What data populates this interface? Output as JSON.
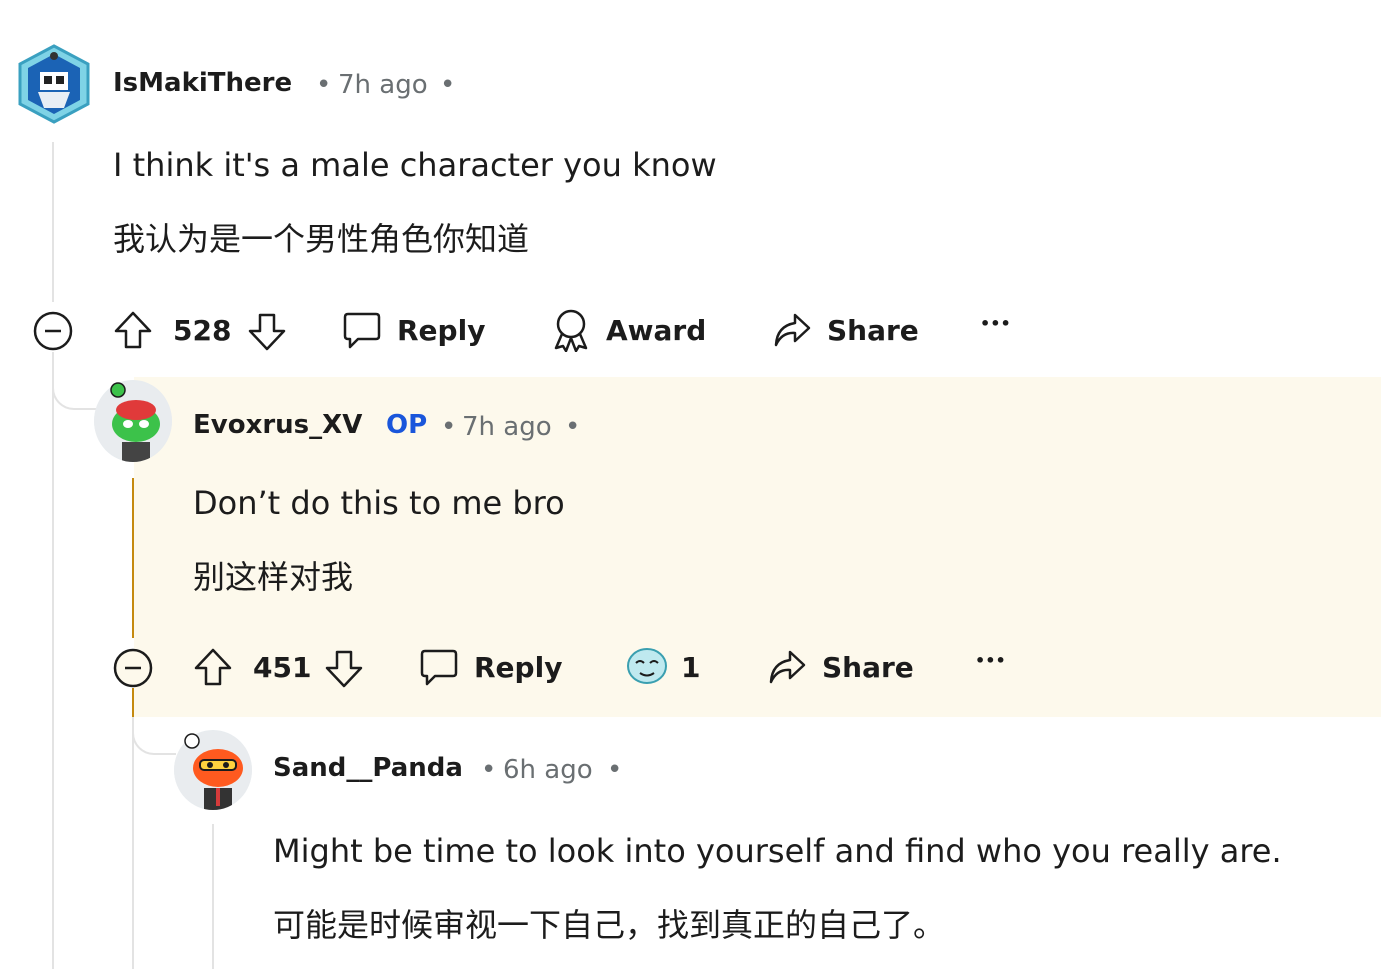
{
  "comments": [
    {
      "username": "IsMakiThere",
      "sep_left": "•",
      "time": "7h ago",
      "sep_right": "•",
      "body": "I think it's a male character you know",
      "translation": "我认为是一个男性角色你知道",
      "votes": "528",
      "reply_label": "Reply",
      "award_label": "Award",
      "share_label": "Share",
      "more_label": "•••"
    },
    {
      "username": "Evoxrus_XV",
      "op_badge": "OP",
      "sep_left": "•",
      "time": "7h ago",
      "sep_right": "•",
      "body": "Don’t do this to me bro",
      "translation": "别这样对我",
      "votes": "451",
      "reply_label": "Reply",
      "award_count": "1",
      "share_label": "Share",
      "more_label": "•••"
    },
    {
      "username": "Sand__Panda",
      "sep_left": "•",
      "time": "6h ago",
      "sep_right": "•",
      "body": "Might be time to look into yourself and find who you really are.",
      "translation": "可能是时候审视一下自己，找到真正的自己了。"
    }
  ],
  "colors": {
    "op_highlight": "#fdf9ec",
    "op_badge": "#1a56db",
    "op_thread": "#c58a10",
    "thread": "#e3e3e3"
  },
  "icons": [
    "minus-circle-icon",
    "upvote-icon",
    "downvote-icon",
    "comment-bubble-icon",
    "award-icon",
    "share-arrow-icon",
    "more-icon",
    "award-emoji-icon"
  ]
}
